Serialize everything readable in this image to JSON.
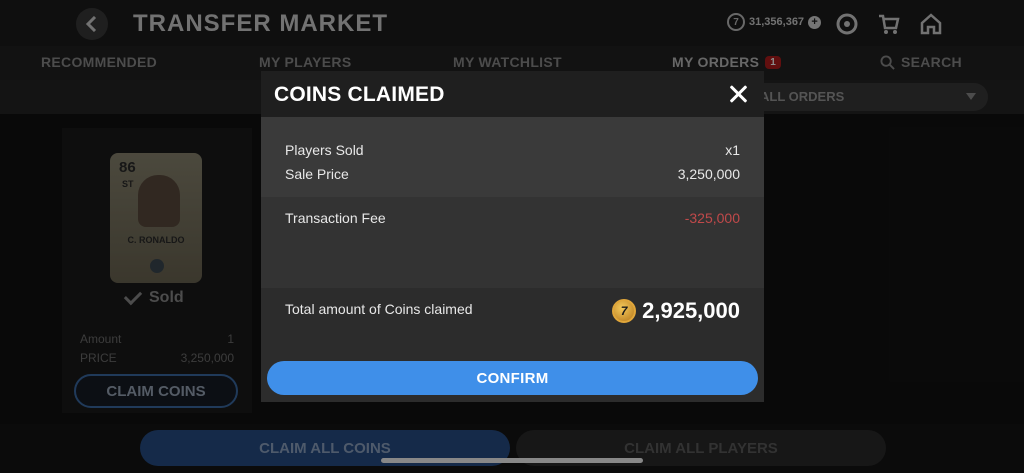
{
  "header": {
    "title": "TRANSFER MARKET",
    "coin_balance": "31,356,367"
  },
  "tabs": [
    {
      "label": "RECOMMENDED"
    },
    {
      "label": "MY PLAYERS"
    },
    {
      "label": "MY WATCHLIST"
    },
    {
      "label": "MY ORDERS",
      "badge": "1"
    },
    {
      "label": "SEARCH"
    }
  ],
  "filter": {
    "selected": "ALL ORDERS"
  },
  "player_card": {
    "rating": "86",
    "position": "ST",
    "name": "C. RONALDO",
    "status": "Sold",
    "amount_label": "Amount",
    "amount_value": "1",
    "price_label": "PRICE",
    "price_value": "3,250,000",
    "claim_button": "CLAIM COINS"
  },
  "bottom_buttons": {
    "claim_all_coins": "CLAIM ALL COINS",
    "claim_all_players": "CLAIM ALL PLAYERS"
  },
  "modal": {
    "title": "COINS CLAIMED",
    "players_sold_label": "Players Sold",
    "players_sold_value": "x1",
    "sale_price_label": "Sale Price",
    "sale_price_value": "3,250,000",
    "fee_label": "Transaction Fee",
    "fee_value": "-325,000",
    "total_label": "Total amount of Coins claimed",
    "total_value": "2,925,000",
    "confirm_label": "CONFIRM"
  },
  "colors": {
    "confirm": "#3f8fe9",
    "fee_negative": "#c0494a",
    "coin_gold": "#e0a63a"
  }
}
